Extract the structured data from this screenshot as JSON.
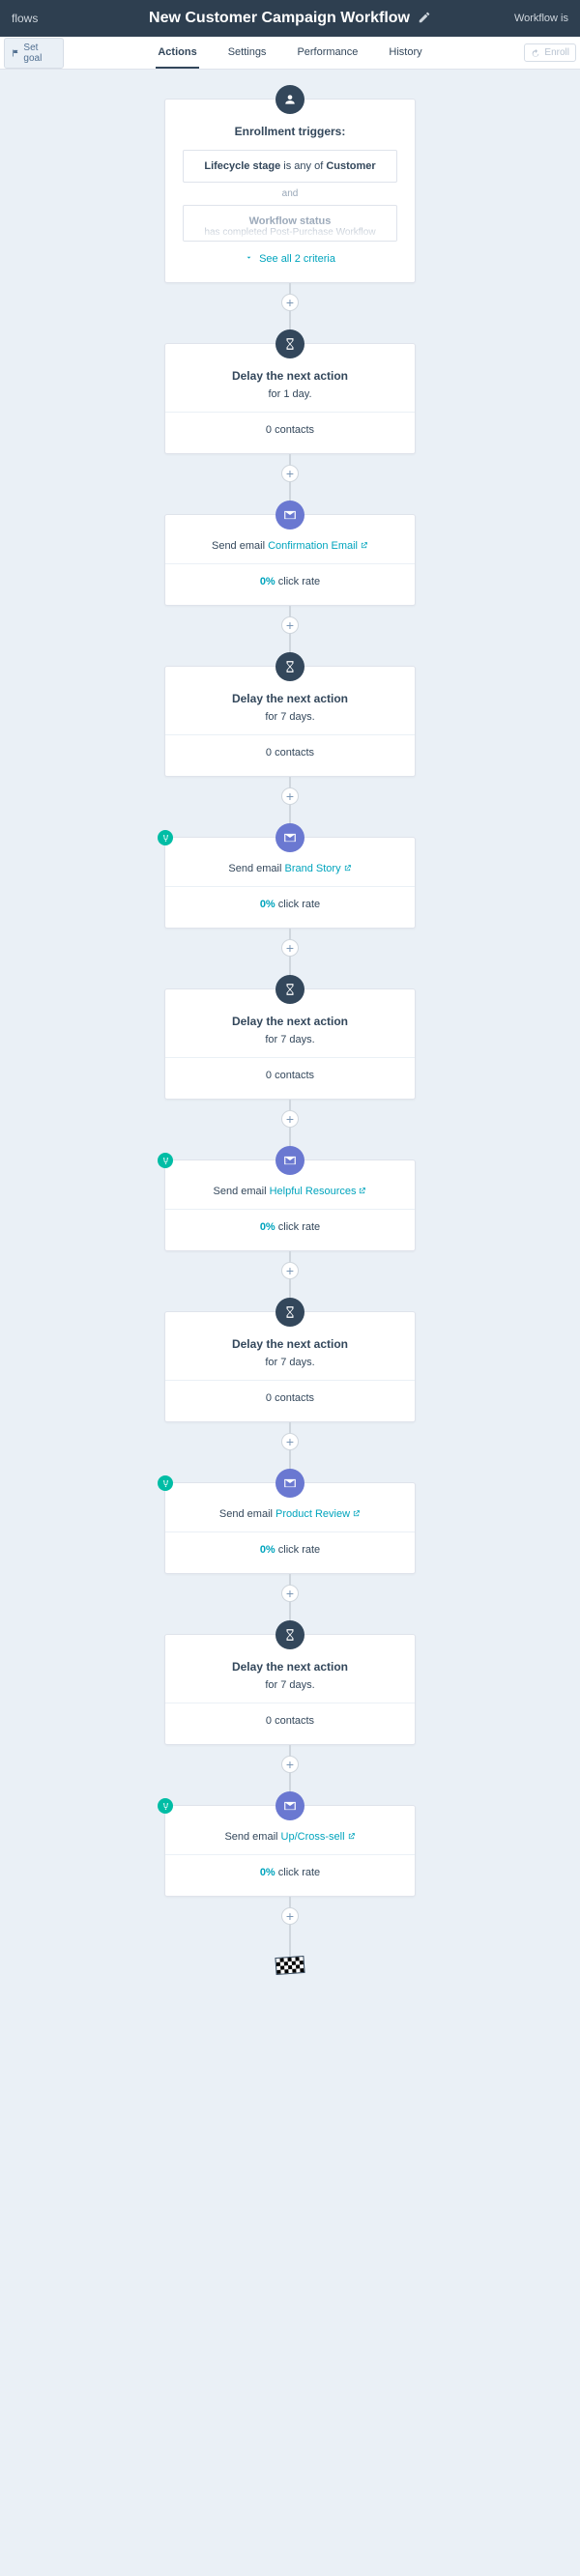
{
  "header": {
    "left_crumb": "flows",
    "title": "New Customer Campaign Workflow",
    "right_crumb": "Workflow is"
  },
  "subhead": {
    "set_goal": "Set goal",
    "tabs": [
      "Actions",
      "Settings",
      "Performance",
      "History"
    ],
    "enroll": "Enroll"
  },
  "trigger": {
    "heading": "Enrollment triggers:",
    "c1_pre": "Lifecycle stage",
    "c1_mid": "is any of",
    "c1_bold": "Customer",
    "and": "and",
    "c2_line1": "Workflow status",
    "c2_line2a": "has completed",
    "c2_line2b": "Post-Purchase Workflow",
    "see_all": "See all 2 criteria"
  },
  "strings": {
    "delay_title": "Delay the next action",
    "send_prefix": "Send email",
    "click_suffix": "click rate",
    "contacts_suffix": "contacts"
  },
  "steps": [
    {
      "kind": "delay",
      "duration": "for 1 day.",
      "contacts": "0"
    },
    {
      "kind": "email",
      "ab": false,
      "name": "Confirmation Email",
      "rate": "0%"
    },
    {
      "kind": "delay",
      "duration": "for 7 days.",
      "contacts": "0"
    },
    {
      "kind": "email",
      "ab": true,
      "name": "Brand Story",
      "rate": "0%"
    },
    {
      "kind": "delay",
      "duration": "for 7 days.",
      "contacts": "0"
    },
    {
      "kind": "email",
      "ab": true,
      "name": "Helpful Resources",
      "rate": "0%"
    },
    {
      "kind": "delay",
      "duration": "for 7 days.",
      "contacts": "0"
    },
    {
      "kind": "email",
      "ab": true,
      "name": "Product Review",
      "rate": "0%"
    },
    {
      "kind": "delay",
      "duration": "for 7 days.",
      "contacts": "0"
    },
    {
      "kind": "email",
      "ab": true,
      "name": "Up/Cross-sell",
      "rate": "0%"
    }
  ]
}
